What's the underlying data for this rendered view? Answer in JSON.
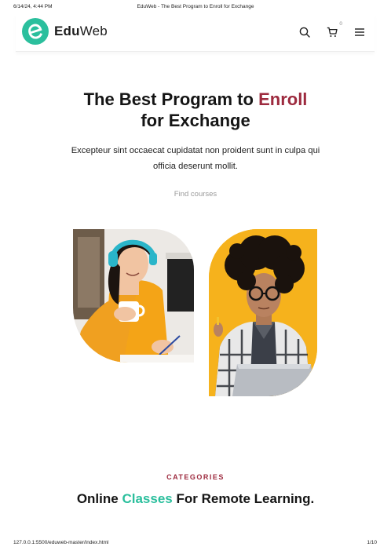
{
  "print": {
    "datetime": "6/14/24, 4:44 PM",
    "doc_title": "EduWeb - The Best Program to Enroll for Exchange",
    "url": "127.0.0.1:5500/eduweb-master/index.html",
    "page": "1/10"
  },
  "brand": {
    "name_bold": "Edu",
    "name_light": "Web",
    "color": "#2bbf9d"
  },
  "nav": {
    "cart_count": "0",
    "icons": [
      "search-icon",
      "cart-icon",
      "menu-icon"
    ]
  },
  "hero": {
    "title_part1": "The Best Program to",
    "title_accent": "Enroll",
    "title_part2": "for Exchange",
    "text": "Excepteur sint occaecat cupidatat non proident sunt in culpa qui officia deserunt mollit.",
    "link": "Find courses",
    "accent_color": "#9d2a3e"
  },
  "categories": {
    "label": "CATEGORIES",
    "title_part1": "Online",
    "title_accent": "Classes",
    "title_part2": "For Remote Learning."
  }
}
